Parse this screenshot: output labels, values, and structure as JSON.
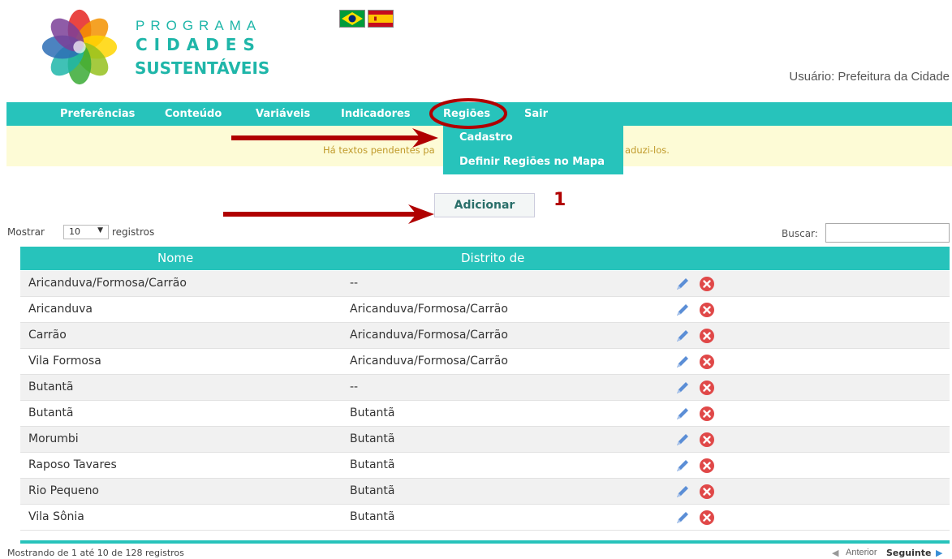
{
  "brand": {
    "line1": "PROGRAMA",
    "line2": "CIDADES",
    "line3": "SUSTENTÁVEIS"
  },
  "user_label": "Usuário: Prefeitura da Cidade",
  "nav": [
    "Preferências",
    "Conteúdo",
    "Variáveis",
    "Indicadores",
    "Regiões",
    "Sair"
  ],
  "dropdown": [
    "Cadastro",
    "Definir Regiões no Mapa"
  ],
  "notice": {
    "left": "Há textos pendentes pa",
    "right": "aduzi-los."
  },
  "add_button": "Adicionar",
  "annotation_number": "1",
  "controls": {
    "show_prefix": "Mostrar",
    "show_value": "10",
    "show_suffix": "registros",
    "search_label": "Buscar:"
  },
  "table": {
    "headers": [
      "Nome",
      "Distrito de"
    ],
    "rows": [
      [
        "Aricanduva/Formosa/Carrão",
        "--"
      ],
      [
        "Aricanduva",
        "Aricanduva/Formosa/Carrão"
      ],
      [
        "Carrão",
        "Aricanduva/Formosa/Carrão"
      ],
      [
        "Vila Formosa",
        "Aricanduva/Formosa/Carrão"
      ],
      [
        "Butantã",
        "--"
      ],
      [
        "Butantã",
        "Butantã"
      ],
      [
        "Morumbi",
        "Butantã"
      ],
      [
        "Raposo Tavares",
        "Butantã"
      ],
      [
        "Rio Pequeno",
        "Butantã"
      ],
      [
        "Vila Sônia",
        "Butantã"
      ]
    ]
  },
  "footer": {
    "info": "Mostrando de 1 até 10 de 128 registros",
    "prev": "Anterior",
    "next": "Seguinte"
  },
  "colors": {
    "teal": "#27c3bb",
    "annotation": "#b00000",
    "notice_bg": "#fdfbd6"
  },
  "icons": [
    "edit-pencil-icon",
    "delete-x-icon",
    "flag-brazil-icon",
    "flag-spain-icon",
    "chevron-down-icon",
    "arrow-left-icon",
    "arrow-right-icon"
  ]
}
